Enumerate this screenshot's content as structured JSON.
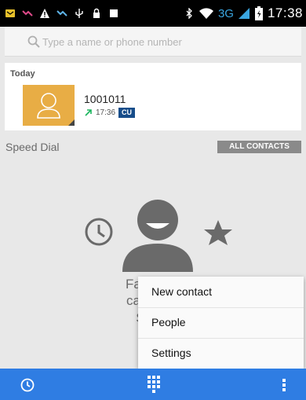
{
  "status_bar": {
    "network": "3G",
    "time": "17:38"
  },
  "search": {
    "placeholder": "Type a name or phone number"
  },
  "recent": {
    "heading": "Today",
    "number": "1001011",
    "call_time": "17:36",
    "call_tag": "CU",
    "call_type_icon": "outgoing-call-arrow-icon"
  },
  "speed_dial": {
    "label": "Speed Dial",
    "all_contacts_label": "ALL CONTACTS"
  },
  "empty_state": {
    "line1": "Favorites",
    "line2": "call often",
    "line3": "So, st"
  },
  "overflow_menu": {
    "items": [
      "New contact",
      "People",
      "Settings"
    ]
  },
  "bottom_nav": {
    "icons": [
      "clock-icon",
      "dialpad-icon",
      "more-vert-icon"
    ]
  },
  "colors": {
    "accent": "#2f7de3",
    "photo_bg": "#e8ad45",
    "call_tag_bg": "#174d8a",
    "outgoing_arrow": "#1bb55e",
    "network_3g": "#3aa6e0"
  }
}
